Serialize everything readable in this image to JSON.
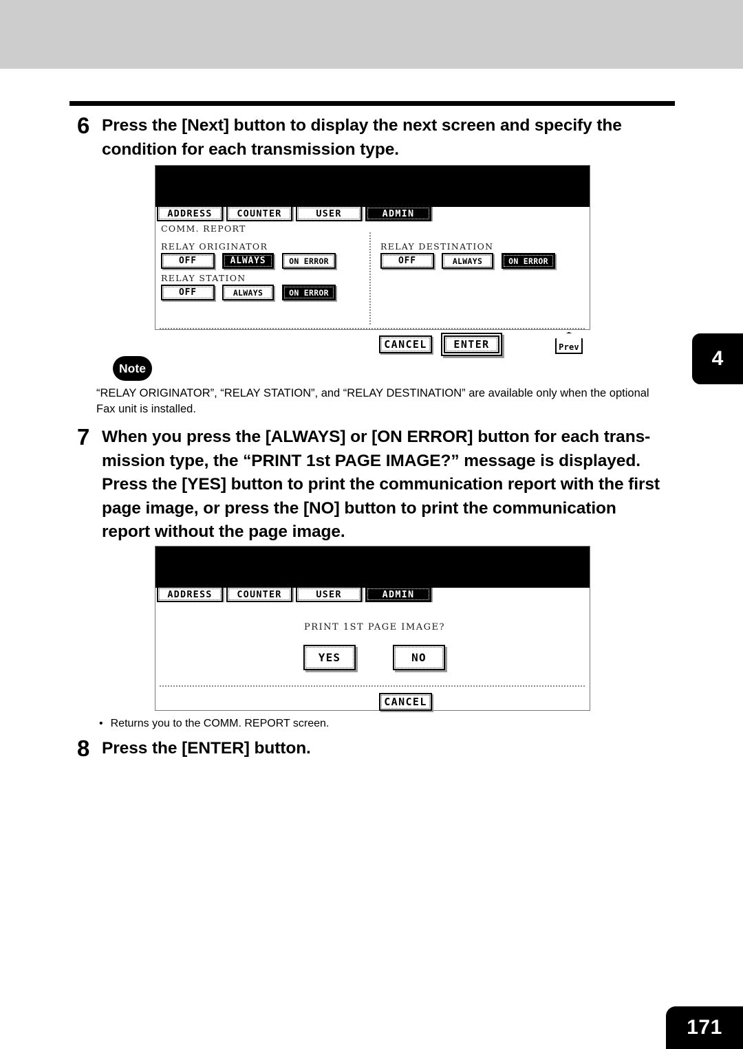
{
  "page": {
    "number": "171",
    "chapter_tab": "4"
  },
  "steps": [
    {
      "num": "6",
      "line1": "Press the [Next] button to display the next screen and specify the",
      "line2": "condition for each transmission type."
    },
    {
      "num": "7",
      "line1": "When you press the [ALWAYS] or [ON ERROR] button for each trans-",
      "line2": "mission type, the “PRINT 1st PAGE IMAGE?” message is displayed.",
      "line3": "Press the [YES] button to print the communication report with the first",
      "line4": "page image, or press the [NO] button to print the communication",
      "line5": "report without the page image."
    },
    {
      "num": "8",
      "line1": "Press the [ENTER] button."
    }
  ],
  "note": {
    "badge": "Note",
    "line1": "“RELAY ORIGINATOR”, “RELAY STATION”, and “RELAY DESTINATION” are available only when the optional",
    "line2": "Fax unit is installed."
  },
  "bullet": {
    "dot": "•",
    "text": "Returns you to the COMM. REPORT screen."
  },
  "screen1": {
    "tabs": [
      {
        "label": "ADDRESS",
        "active": false
      },
      {
        "label": "COUNTER",
        "active": false
      },
      {
        "label": "USER",
        "active": false
      },
      {
        "label": "ADMIN",
        "active": true
      }
    ],
    "title": "COMM. REPORT",
    "groups": [
      {
        "label": "RELAY ORIGINATOR",
        "options": [
          {
            "label": "OFF",
            "selected": false
          },
          {
            "label": "ALWAYS",
            "selected": true
          },
          {
            "label": "ON ERROR",
            "selected": false
          }
        ]
      },
      {
        "label": "RELAY STATION",
        "options": [
          {
            "label": "OFF",
            "selected": false
          },
          {
            "label": "ALWAYS",
            "selected": false
          },
          {
            "label": "ON ERROR",
            "selected": true
          }
        ]
      },
      {
        "label": "RELAY DESTINATION",
        "options": [
          {
            "label": "OFF",
            "selected": false
          },
          {
            "label": "ALWAYS",
            "selected": false
          },
          {
            "label": "ON ERROR",
            "selected": true
          }
        ]
      }
    ],
    "cancel_label": "CANCEL",
    "enter_label": "ENTER",
    "prev_label": "Prev"
  },
  "screen2": {
    "tabs": [
      {
        "label": "ADDRESS",
        "active": false
      },
      {
        "label": "COUNTER",
        "active": false
      },
      {
        "label": "USER",
        "active": false
      },
      {
        "label": "ADMIN",
        "active": true
      }
    ],
    "message": "PRINT 1ST PAGE IMAGE?",
    "yes_label": "YES",
    "no_label": "NO",
    "cancel_label": "CANCEL"
  }
}
